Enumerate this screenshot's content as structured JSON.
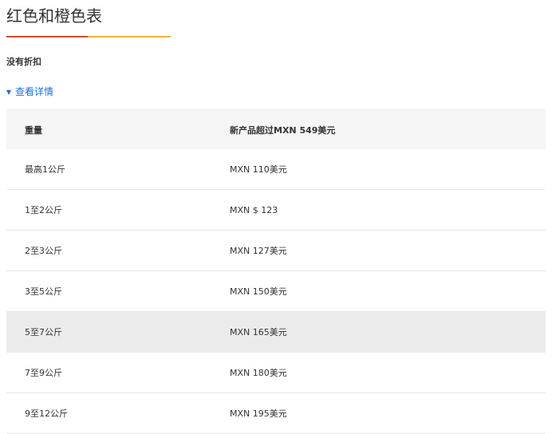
{
  "page": {
    "title": "红色和橙色表",
    "subtitle": "没有折扣",
    "details_toggle": "查看详情"
  },
  "colors": {
    "underline_red": "#d9473b",
    "underline_orange": "#f0b43a",
    "link_blue": "#1f6fd1",
    "header_bg": "#f5f5f5",
    "highlight_row_bg": "#ebebeb"
  },
  "table": {
    "headers": {
      "weight": "重量",
      "price": "新产品超过MXN 549美元"
    },
    "rows": [
      {
        "weight": "最高1公斤",
        "price": "MXN 110美元"
      },
      {
        "weight": "1至2公斤",
        "price": "MXN $ 123"
      },
      {
        "weight": "2至3公斤",
        "price": "MXN 127美元"
      },
      {
        "weight": "3至5公斤",
        "price": "MXN 150美元"
      },
      {
        "weight": "5至7公斤",
        "price": "MXN 165美元"
      },
      {
        "weight": "7至9公斤",
        "price": "MXN 180美元"
      },
      {
        "weight": "9至12公斤",
        "price": "MXN 195美元"
      }
    ],
    "highlighted_row": 4
  }
}
